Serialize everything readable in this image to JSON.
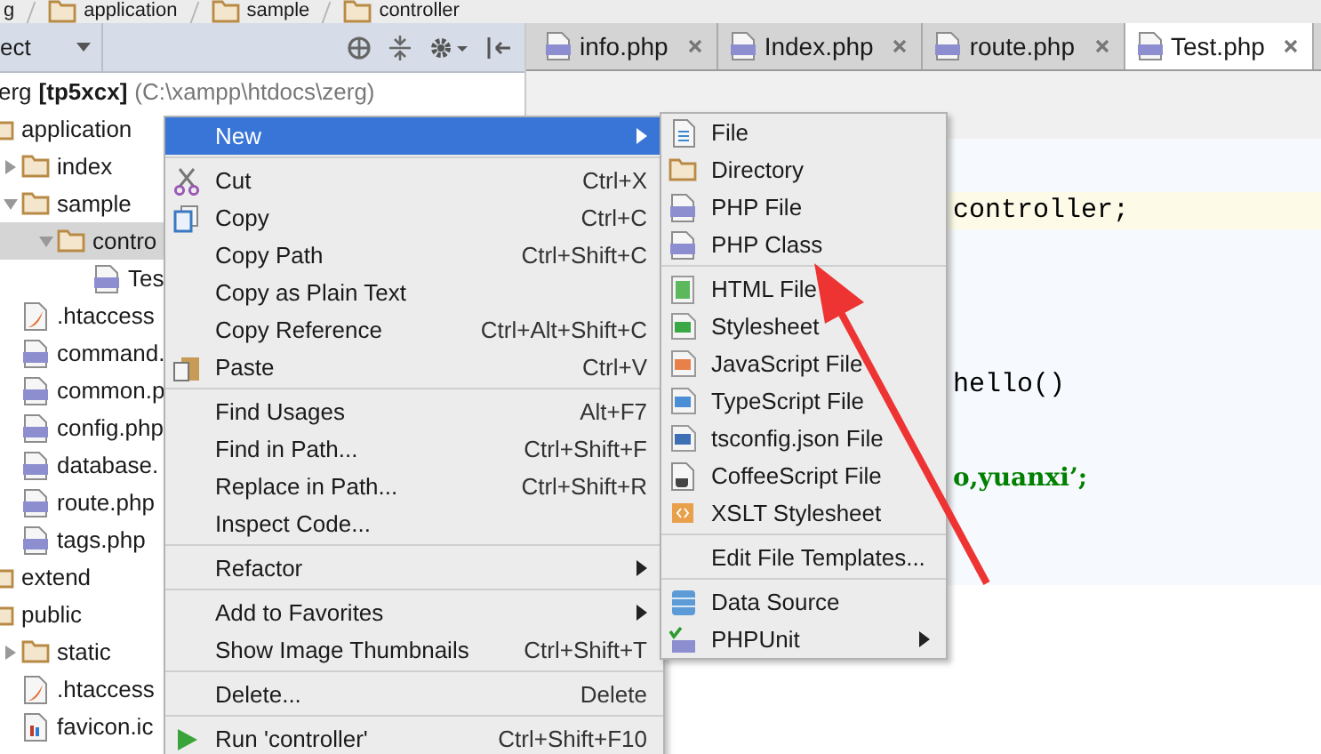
{
  "breadcrumb": [
    "g",
    "application",
    "sample",
    "controller"
  ],
  "project_panel": {
    "view_selector": "ect",
    "root": {
      "name": "erg",
      "module": "[tp5xcx]",
      "path": "(C:\\xampp\\htdocs\\zerg)"
    },
    "tree": [
      {
        "label": "application",
        "kind": "folder",
        "selected": false,
        "children": [
          {
            "label": "index",
            "kind": "folder",
            "expanded": false,
            "selected": false
          },
          {
            "label": "sample",
            "kind": "folder",
            "expanded": true,
            "selected": false,
            "children": [
              {
                "label": "contro",
                "kind": "folder",
                "expanded": true,
                "selected": true,
                "children": [
                  {
                    "label": "Tes",
                    "kind": "php",
                    "selected": false
                  }
                ]
              }
            ]
          },
          {
            "label": ".htaccess",
            "kind": "config",
            "selected": false
          },
          {
            "label": "command.",
            "kind": "php",
            "selected": false
          },
          {
            "label": "common.p",
            "kind": "php",
            "selected": false
          },
          {
            "label": "config.php",
            "kind": "php",
            "selected": false
          },
          {
            "label": "database.",
            "kind": "php",
            "selected": false
          },
          {
            "label": "route.php",
            "kind": "php",
            "selected": false
          },
          {
            "label": "tags.php",
            "kind": "php",
            "selected": false
          }
        ]
      },
      {
        "label": "extend",
        "kind": "folder",
        "selected": false
      },
      {
        "label": "public",
        "kind": "folder",
        "selected": false,
        "children": [
          {
            "label": "static",
            "kind": "folder",
            "expanded": false,
            "selected": false
          },
          {
            "label": ".htaccess",
            "kind": "config",
            "selected": false
          },
          {
            "label": "favicon.ic",
            "kind": "image",
            "selected": false
          }
        ]
      }
    ]
  },
  "tabs": [
    {
      "label": "info.php",
      "selected": false
    },
    {
      "label": "Index.php",
      "selected": false
    },
    {
      "label": "route.php",
      "selected": false
    },
    {
      "label": "Test.php",
      "selected": true
    }
  ],
  "code_lines": [
    {
      "text": "controller;",
      "kind": "current"
    },
    {
      "text": "hello()",
      "kind": "plain"
    },
    {
      "text": "o,yuanxi’;",
      "kind": "string"
    }
  ],
  "context_menu": {
    "groups": [
      [
        {
          "label": "New",
          "submenu": true,
          "selected": true
        }
      ],
      [
        {
          "label": "Cut",
          "kind": "cut",
          "shortcut": "Ctrl+X",
          "selected": false
        },
        {
          "label": "Copy",
          "kind": "copy",
          "shortcut": "Ctrl+C",
          "selected": false
        },
        {
          "label": "Copy Path",
          "shortcut": "Ctrl+Shift+C",
          "selected": false
        },
        {
          "label": "Copy as Plain Text",
          "selected": false
        },
        {
          "label": "Copy Reference",
          "shortcut": "Ctrl+Alt+Shift+C",
          "selected": false
        },
        {
          "label": "Paste",
          "kind": "paste",
          "shortcut": "Ctrl+V",
          "selected": false
        }
      ],
      [
        {
          "label": "Find Usages",
          "shortcut": "Alt+F7",
          "selected": false
        },
        {
          "label": "Find in Path...",
          "shortcut": "Ctrl+Shift+F",
          "selected": false
        },
        {
          "label": "Replace in Path...",
          "shortcut": "Ctrl+Shift+R",
          "selected": false
        },
        {
          "label": "Inspect Code...",
          "selected": false
        }
      ],
      [
        {
          "label": "Refactor",
          "submenu": true,
          "selected": false
        }
      ],
      [
        {
          "label": "Add to Favorites",
          "submenu": true,
          "selected": false
        },
        {
          "label": "Show Image Thumbnails",
          "shortcut": "Ctrl+Shift+T",
          "selected": false
        }
      ],
      [
        {
          "label": "Delete...",
          "shortcut": "Delete",
          "selected": false
        }
      ],
      [
        {
          "label": "Run 'controller'",
          "kind": "run",
          "shortcut": "Ctrl+Shift+F10",
          "selected": false
        }
      ]
    ]
  },
  "new_submenu": {
    "groups": [
      [
        {
          "label": "File",
          "kind": "file",
          "selected": false
        },
        {
          "label": "Directory",
          "kind": "folder",
          "selected": false
        },
        {
          "label": "PHP File",
          "kind": "php",
          "selected": false
        },
        {
          "label": "PHP Class",
          "kind": "php",
          "selected": false
        }
      ],
      [
        {
          "label": "HTML File",
          "kind": "html",
          "selected": false
        },
        {
          "label": "Stylesheet",
          "kind": "css",
          "selected": false
        },
        {
          "label": "JavaScript File",
          "kind": "js",
          "selected": false
        },
        {
          "label": "TypeScript File",
          "kind": "ts",
          "selected": false
        },
        {
          "label": "tsconfig.json File",
          "kind": "json",
          "selected": false
        },
        {
          "label": "CoffeeScript File",
          "kind": "coffee",
          "selected": false
        },
        {
          "label": "XSLT Stylesheet",
          "kind": "xslt",
          "selected": false
        }
      ],
      [
        {
          "label": "Edit File Templates...",
          "selected": false
        }
      ],
      [
        {
          "label": "Data Source",
          "kind": "database",
          "selected": false
        },
        {
          "label": "PHPUnit",
          "kind": "phpunit",
          "submenu": true,
          "selected": false
        }
      ]
    ]
  }
}
